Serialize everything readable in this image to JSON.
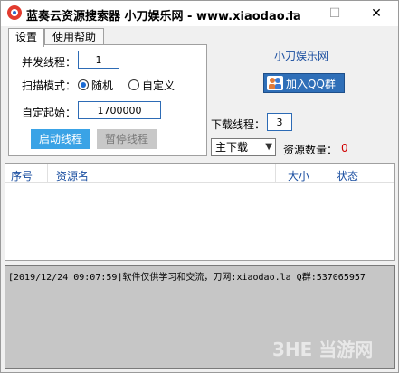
{
  "window": {
    "title": "蓝奏云资源搜索器  小刀娱乐网 - www.xiaodao.la",
    "min": "—",
    "max": "☐",
    "close": "✕"
  },
  "tabs": [
    "设置",
    "使用帮助"
  ],
  "settings": {
    "concurrency_label": "并发线程：",
    "concurrency_value": "1",
    "scan_mode_label": "扫描模式：",
    "scan_mode_options": [
      "随机",
      "自定义"
    ],
    "start_label": "自定起始：",
    "start_value": "1700000",
    "start_button": "启动线程",
    "pause_button": "暂停线程"
  },
  "right": {
    "site_link": "小刀娱乐网",
    "qq_button": "加入QQ群",
    "download_threads_label": "下载线程：",
    "download_threads_value": "3",
    "download_select": "主下载",
    "resource_count_label": "资源数量：",
    "resource_count_value": "0"
  },
  "table": {
    "columns": [
      "序号",
      "资源名",
      "大小",
      "状态"
    ]
  },
  "log": {
    "line": "[2019/12/24 09:07:59]软件仅供学习和交流，刀网:xiaodao.la Q群:537065957"
  },
  "watermark": "3HE 当游网",
  "colors": {
    "accent": "#3aa3e6",
    "qq": "#2f6fb8",
    "count": "#d00000"
  }
}
